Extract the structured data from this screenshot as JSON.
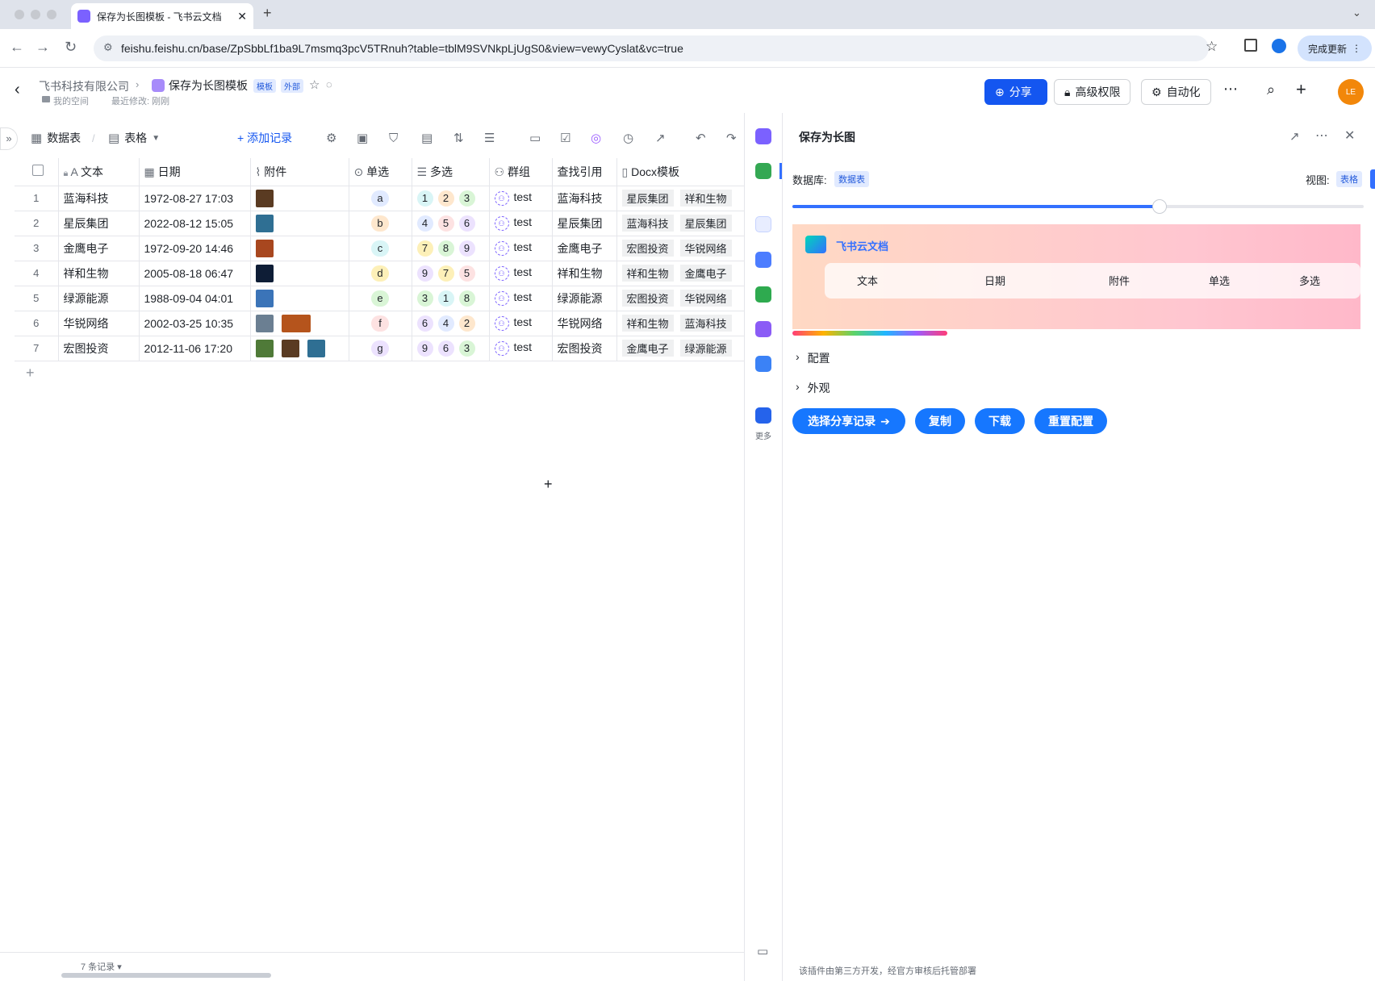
{
  "browser": {
    "tab_title": "保存为长图模板 - 飞书云文档",
    "url": "feishu.feishu.cn/base/ZpSbbLf1ba9L7msmq3pcV5TRnuh?table=tblM9SVNkpLjUgS0&view=vewyCyslat&vc=true",
    "update_label": "完成更新"
  },
  "header": {
    "org": "飞书科技有限公司",
    "title": "保存为长图模板",
    "tag_template": "模板",
    "tag_external": "外部",
    "space": "我的空间",
    "last_modified": "最近修改: 刚刚",
    "share_label": "分享",
    "permission_label": "高级权限",
    "automation_label": "自动化",
    "avatar_initials": "LE"
  },
  "toolbar": {
    "table_label": "数据表",
    "view_label": "表格",
    "add_record_label": "+ 添加记录"
  },
  "grid": {
    "columns": [
      "文本",
      "日期",
      "附件",
      "单选",
      "多选",
      "群组",
      "查找引用",
      "Docx模板"
    ],
    "rows": [
      {
        "n": "1",
        "text": "蓝海科技",
        "date": "1972-08-27  17:03",
        "single": "a",
        "multi": [
          "1",
          "2",
          "3"
        ],
        "group": "test",
        "lookup": "蓝海科技",
        "docx": [
          "星辰集团",
          "祥和生物"
        ]
      },
      {
        "n": "2",
        "text": "星辰集团",
        "date": "2022-08-12  15:05",
        "single": "b",
        "multi": [
          "4",
          "5",
          "6"
        ],
        "group": "test",
        "lookup": "星辰集团",
        "docx": [
          "蓝海科技",
          "星辰集团"
        ]
      },
      {
        "n": "3",
        "text": "金鹰电子",
        "date": "1972-09-20  14:46",
        "single": "c",
        "multi": [
          "7",
          "8",
          "9"
        ],
        "group": "test",
        "lookup": "金鹰电子",
        "docx": [
          "宏图投资",
          "华锐网络"
        ]
      },
      {
        "n": "4",
        "text": "祥和生物",
        "date": "2005-08-18  06:47",
        "single": "d",
        "multi": [
          "9",
          "7",
          "5"
        ],
        "group": "test",
        "lookup": "祥和生物",
        "docx": [
          "祥和生物",
          "金鹰电子"
        ]
      },
      {
        "n": "5",
        "text": "绿源能源",
        "date": "1988-09-04  04:01",
        "single": "e",
        "multi": [
          "3",
          "1",
          "8"
        ],
        "group": "test",
        "lookup": "绿源能源",
        "docx": [
          "宏图投资",
          "华锐网络"
        ]
      },
      {
        "n": "6",
        "text": "华锐网络",
        "date": "2002-03-25  10:35",
        "single": "f",
        "multi": [
          "6",
          "4",
          "2"
        ],
        "group": "test",
        "lookup": "华锐网络",
        "docx": [
          "祥和生物",
          "蓝海科技"
        ]
      },
      {
        "n": "7",
        "text": "宏图投资",
        "date": "2012-11-06   17:20",
        "single": "g",
        "multi": [
          "9",
          "6",
          "3"
        ],
        "group": "test",
        "lookup": "宏图投资",
        "docx": [
          "金鹰电子",
          "绿源能源"
        ]
      }
    ],
    "record_count": "7 条记录"
  },
  "rail": {
    "more_label": "更多"
  },
  "panel": {
    "title": "保存为长图",
    "db_label": "数据库:",
    "db_value": "数据表",
    "view_label": "视图:",
    "view_value": "表格",
    "brand": "飞书云文档",
    "preview_columns": [
      "文本",
      "日期",
      "附件",
      "单选",
      "多选"
    ],
    "section_config": "配置",
    "section_appearance": "外观",
    "btn_select": "选择分享记录",
    "btn_copy": "复制",
    "btn_download": "下载",
    "btn_reset": "重置配置",
    "footer": "该插件由第三方开发，经官方审核后托管部署"
  },
  "colors": {
    "primary": "#1456f0",
    "panel_button": "#1677ff",
    "avatar": "#f2870a"
  }
}
